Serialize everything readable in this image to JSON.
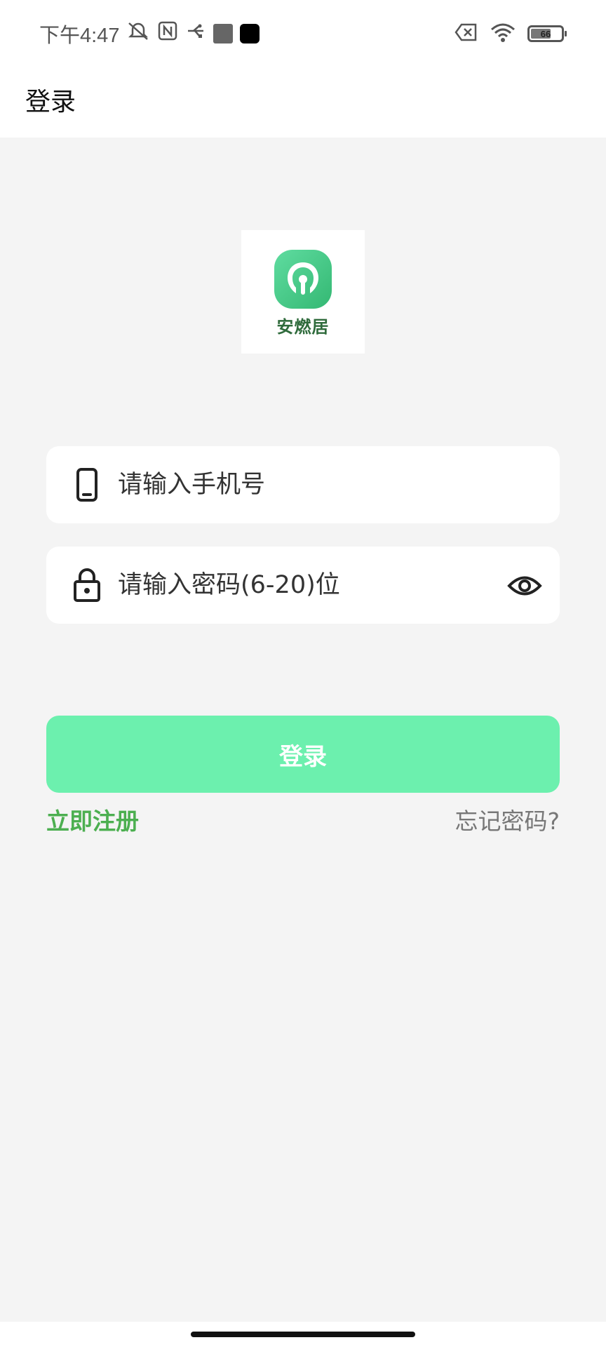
{
  "status_bar": {
    "time": "下午4:47",
    "battery": "66"
  },
  "app_bar": {
    "title": "登录"
  },
  "logo": {
    "app_name": "安燃居",
    "brand_color": "#3cc07e"
  },
  "form": {
    "phone_placeholder": "请输入手机号",
    "password_placeholder": "请输入密码(6-20)位"
  },
  "actions": {
    "login_label": "登录",
    "register_label": "立即注册",
    "forgot_label": "忘记密码?"
  },
  "colors": {
    "login_button": "#6cf0ae",
    "register_link": "#4caf50",
    "background": "#f4f4f4"
  }
}
